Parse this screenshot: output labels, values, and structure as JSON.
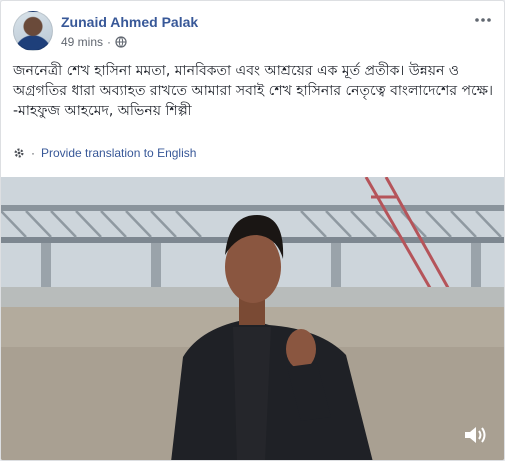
{
  "post": {
    "author": "Zunaid Ahmed Palak",
    "timestamp": "49 mins",
    "separator": "·",
    "privacy_icon": "globe-icon",
    "text_lines": [
      "জননেত্রী শেখ হাসিনা মমতা, মানবিকতা এবং আশ্রয়ের এক মূর্ত প্রতীক। উন্নয়ন ও অগ্রগতির ধারা অব্যাহত রাখতে আমারা সবাই শেখ হাসিনার নেতৃত্বে বাংলাদেশের পক্ষে।",
      "-মাহফুজ আহমেদ, অভিনয় শিল্পী"
    ],
    "translation_link": "Provide translation to English"
  },
  "video": {
    "volume_icon": "volume-icon"
  },
  "colors": {
    "link": "#385898",
    "text": "#1d2129",
    "meta": "#616770"
  }
}
